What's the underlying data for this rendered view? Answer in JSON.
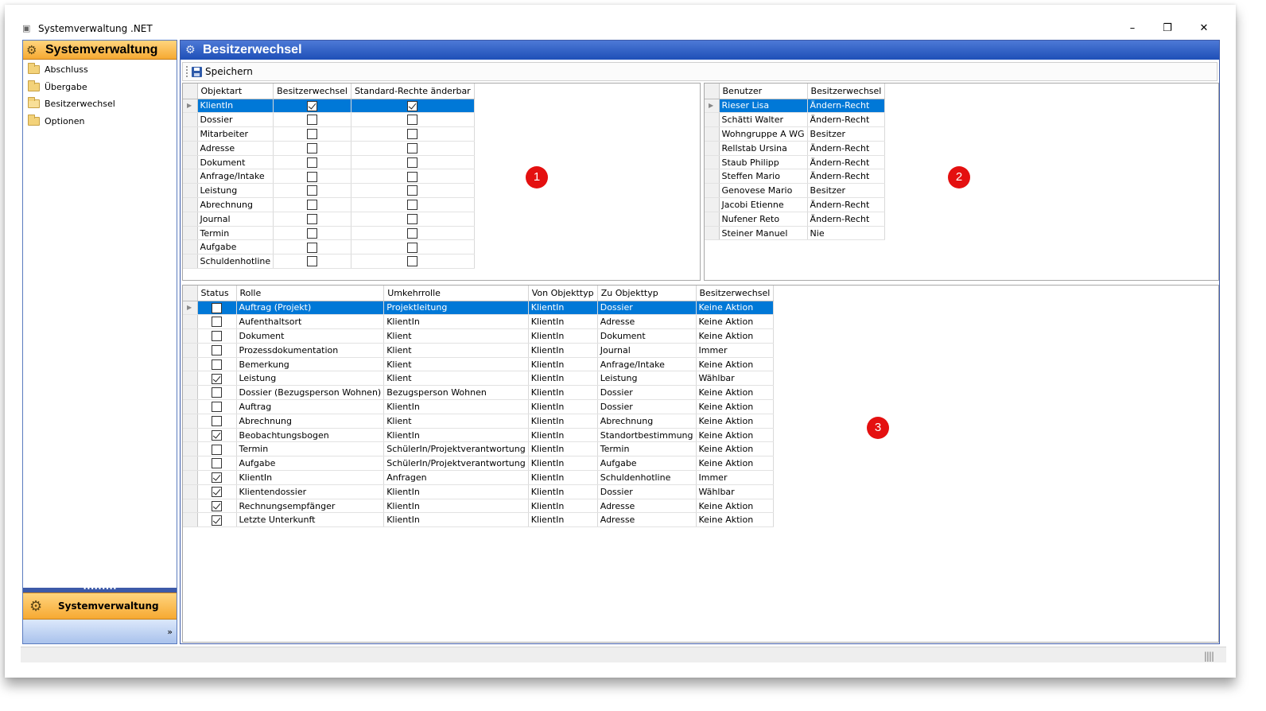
{
  "window": {
    "title": "Systemverwaltung .NET",
    "minimize": "–",
    "restore": "❐",
    "close": "✕"
  },
  "nav": {
    "header": "Systemverwaltung",
    "items": [
      {
        "label": "Abschluss"
      },
      {
        "label": "Übergabe"
      },
      {
        "label": "Besitzerwechsel"
      },
      {
        "label": "Optionen"
      }
    ],
    "splitter": "•••••••••",
    "bottom_button": "Systemverwaltung",
    "footer_chevron": "»"
  },
  "main": {
    "header": "Besitzerwechsel",
    "toolbar": {
      "save_label": "Speichern"
    }
  },
  "grid1": {
    "columns": [
      "Objektart",
      "Besitzerwechsel",
      "Standard-Rechte änderbar"
    ],
    "rows": [
      {
        "objektart": "KlientIn",
        "besitzerwechsel": true,
        "standard": true,
        "selected": true
      },
      {
        "objektart": "Dossier",
        "besitzerwechsel": false,
        "standard": false
      },
      {
        "objektart": "Mitarbeiter",
        "besitzerwechsel": false,
        "standard": false
      },
      {
        "objektart": "Adresse",
        "besitzerwechsel": false,
        "standard": false
      },
      {
        "objektart": "Dokument",
        "besitzerwechsel": false,
        "standard": false
      },
      {
        "objektart": "Anfrage/Intake",
        "besitzerwechsel": false,
        "standard": false
      },
      {
        "objektart": "Leistung",
        "besitzerwechsel": false,
        "standard": false
      },
      {
        "objektart": "Abrechnung",
        "besitzerwechsel": false,
        "standard": false
      },
      {
        "objektart": "Journal",
        "besitzerwechsel": false,
        "standard": false
      },
      {
        "objektart": "Termin",
        "besitzerwechsel": false,
        "standard": false
      },
      {
        "objektart": "Aufgabe",
        "besitzerwechsel": false,
        "standard": false
      },
      {
        "objektart": "Schuldenhotline",
        "besitzerwechsel": false,
        "standard": false
      }
    ]
  },
  "grid2": {
    "columns": [
      "Benutzer",
      "Besitzerwechsel"
    ],
    "rows": [
      {
        "benutzer": "Rieser Lisa",
        "besitzerwechsel": "Ändern-Recht",
        "selected": true
      },
      {
        "benutzer": "Schätti Walter",
        "besitzerwechsel": "Ändern-Recht"
      },
      {
        "benutzer": "Wohngruppe A WG",
        "besitzerwechsel": "Besitzer"
      },
      {
        "benutzer": "Rellstab Ursina",
        "besitzerwechsel": "Ändern-Recht"
      },
      {
        "benutzer": "Staub Philipp",
        "besitzerwechsel": "Ändern-Recht"
      },
      {
        "benutzer": "Steffen Mario",
        "besitzerwechsel": "Ändern-Recht"
      },
      {
        "benutzer": "Genovese Mario",
        "besitzerwechsel": "Besitzer"
      },
      {
        "benutzer": "Jacobi Etienne",
        "besitzerwechsel": "Ändern-Recht"
      },
      {
        "benutzer": "Nufener Reto",
        "besitzerwechsel": "Ändern-Recht"
      },
      {
        "benutzer": "Steiner Manuel",
        "besitzerwechsel": "Nie"
      }
    ]
  },
  "grid3": {
    "columns": [
      "Status",
      "Rolle",
      "Umkehrrolle",
      "Von Objekttyp",
      "Zu Objekttyp",
      "Besitzerwechsel"
    ],
    "rows": [
      {
        "status": false,
        "rolle": "Auftrag (Projekt)",
        "umkehrrolle": "Projektleitung",
        "von": "KlientIn",
        "zu": "Dossier",
        "besitzerwechsel": "Keine Aktion",
        "selected": true
      },
      {
        "status": false,
        "rolle": "Aufenthaltsort",
        "umkehrrolle": "KlientIn",
        "von": "KlientIn",
        "zu": "Adresse",
        "besitzerwechsel": "Keine Aktion"
      },
      {
        "status": false,
        "rolle": "Dokument",
        "umkehrrolle": "Klient",
        "von": "KlientIn",
        "zu": "Dokument",
        "besitzerwechsel": "Keine Aktion"
      },
      {
        "status": false,
        "rolle": "Prozessdokumentation",
        "umkehrrolle": "Klient",
        "von": "KlientIn",
        "zu": "Journal",
        "besitzerwechsel": "Immer"
      },
      {
        "status": false,
        "rolle": "Bemerkung",
        "umkehrrolle": "Klient",
        "von": "KlientIn",
        "zu": "Anfrage/Intake",
        "besitzerwechsel": "Keine Aktion"
      },
      {
        "status": true,
        "rolle": "Leistung",
        "umkehrrolle": "Klient",
        "von": "KlientIn",
        "zu": "Leistung",
        "besitzerwechsel": "Wählbar"
      },
      {
        "status": false,
        "rolle": "Dossier (Bezugsperson Wohnen)",
        "umkehrrolle": "Bezugsperson Wohnen",
        "von": "KlientIn",
        "zu": "Dossier",
        "besitzerwechsel": "Keine Aktion"
      },
      {
        "status": false,
        "rolle": "Auftrag",
        "umkehrrolle": "KlientIn",
        "von": "KlientIn",
        "zu": "Dossier",
        "besitzerwechsel": "Keine Aktion"
      },
      {
        "status": false,
        "rolle": "Abrechnung",
        "umkehrrolle": "Klient",
        "von": "KlientIn",
        "zu": "Abrechnung",
        "besitzerwechsel": "Keine Aktion"
      },
      {
        "status": true,
        "rolle": "Beobachtungsbogen",
        "umkehrrolle": "KlientIn",
        "von": "KlientIn",
        "zu": "Standortbestimmung",
        "besitzerwechsel": "Keine Aktion"
      },
      {
        "status": false,
        "rolle": "Termin",
        "umkehrrolle": "SchülerIn/Projektverantwortung",
        "von": "KlientIn",
        "zu": "Termin",
        "besitzerwechsel": "Keine Aktion"
      },
      {
        "status": false,
        "rolle": "Aufgabe",
        "umkehrrolle": "SchülerIn/Projektverantwortung",
        "von": "KlientIn",
        "zu": "Aufgabe",
        "besitzerwechsel": "Keine Aktion"
      },
      {
        "status": true,
        "rolle": "KlientIn",
        "umkehrrolle": "Anfragen",
        "von": "KlientIn",
        "zu": "Schuldenhotline",
        "besitzerwechsel": "Immer"
      },
      {
        "status": true,
        "rolle": "Klientendossier",
        "umkehrrolle": "KlientIn",
        "von": "KlientIn",
        "zu": "Dossier",
        "besitzerwechsel": "Wählbar"
      },
      {
        "status": true,
        "rolle": "Rechnungsempfänger",
        "umkehrrolle": "KlientIn",
        "von": "KlientIn",
        "zu": "Adresse",
        "besitzerwechsel": "Keine Aktion"
      },
      {
        "status": true,
        "rolle": "Letzte Unterkunft",
        "umkehrrolle": "KlientIn",
        "von": "KlientIn",
        "zu": "Adresse",
        "besitzerwechsel": "Keine Aktion"
      }
    ]
  },
  "markers": [
    "1",
    "2",
    "3"
  ],
  "statusbar": {
    "grip": "||||"
  },
  "colors": {
    "selection": "#0078d7",
    "nav_accent": "#f6a932",
    "header_blue": "#1e4fb7",
    "marker_red": "#e41010"
  }
}
